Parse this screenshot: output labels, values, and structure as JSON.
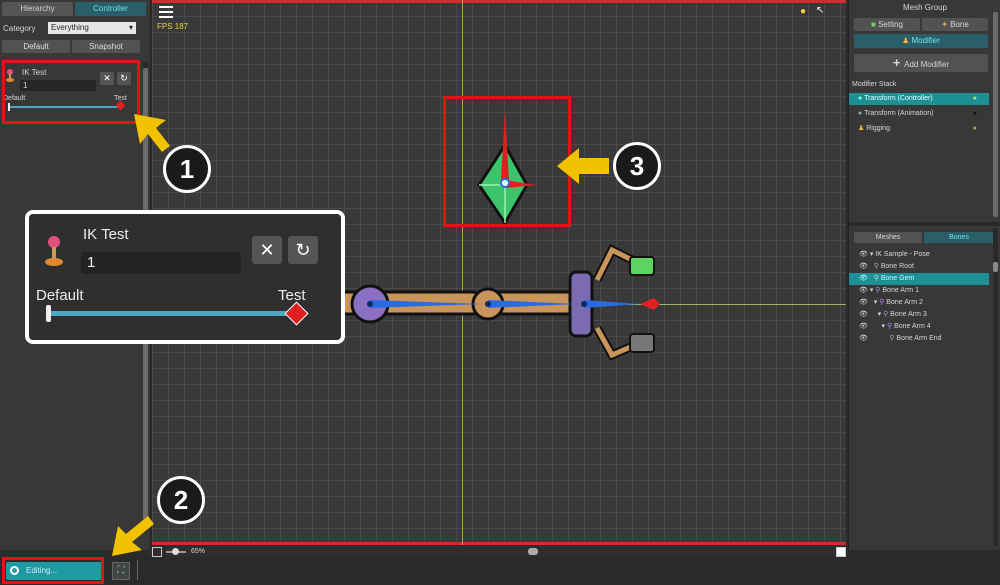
{
  "left": {
    "tabs": [
      "Hierarchy",
      "Controller"
    ],
    "category_label": "Category",
    "category_value": "Everything",
    "default_button": "Default",
    "snapshot_button": "Snapshot",
    "param": {
      "name": "IK Test",
      "value": "1",
      "min_label": "Default",
      "max_label": "Test"
    }
  },
  "viewport": {
    "fps": "FPS 187",
    "zoom": "65%"
  },
  "zoom_panel": {
    "name": "IK Test",
    "value": "1",
    "min_label": "Default",
    "max_label": "Test"
  },
  "status": {
    "editing": "Editing..."
  },
  "callouts": [
    "1",
    "2",
    "3"
  ],
  "right": {
    "title": "Mesh Group",
    "tabs": [
      "Setting",
      "Bone"
    ],
    "modifier_tab": "Modifier",
    "add_modifier": "Add Modifier",
    "stack_title": "Modifier Stack",
    "modifiers": [
      "Transform (Controller)",
      "Transform (Animation)",
      "Rigging"
    ],
    "lower_tabs": [
      "Meshes",
      "Bones"
    ],
    "bones": [
      {
        "label": "IK Sample - Pose"
      },
      {
        "label": "Bone Root"
      },
      {
        "label": "Bone Gem"
      },
      {
        "label": "Bone Arm 1"
      },
      {
        "label": "Bone Arm 2"
      },
      {
        "label": "Bone Arm 3"
      },
      {
        "label": "Bone Arm 4"
      },
      {
        "label": "Bone Arm End"
      }
    ]
  },
  "colors": {
    "accent": "#2a8f8f",
    "highlight": "#e01414",
    "callout_arrow": "#f2c200"
  }
}
